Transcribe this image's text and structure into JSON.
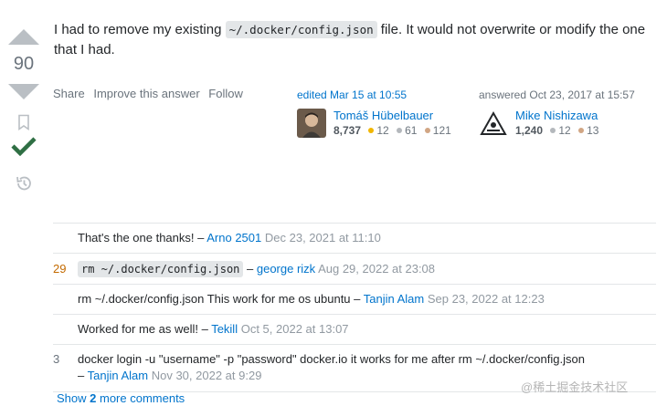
{
  "vote": {
    "count": "90"
  },
  "post": {
    "text_before": "I had to remove my existing ",
    "code": "~/.docker/config.json",
    "text_after": " file. It would not overwrite or modify the one that I had."
  },
  "menu": {
    "share": "Share",
    "improve": "Improve this answer",
    "follow": "Follow"
  },
  "edited": {
    "action": "edited Mar 15 at 10:55",
    "name": "Tomáš Hübelbauer",
    "rep": "8,737",
    "gold": "12",
    "silver": "61",
    "bronze": "121"
  },
  "answered": {
    "action": "answered Oct 23, 2017 at 15:57",
    "name": "Mike Nishizawa",
    "rep": "1,240",
    "silver": "12",
    "bronze": "13"
  },
  "comments": [
    {
      "score": "",
      "text": "That's the one thanks! – ",
      "user": "Arno 2501",
      "date": "Dec 23, 2021 at 11:10"
    },
    {
      "score": "29",
      "code": "rm ~/.docker/config.json",
      "sep": " – ",
      "user": "george rizk",
      "date": "Aug 29, 2022 at 23:08"
    },
    {
      "score": "",
      "text": "rm ~/.docker/config.json This work for me os ubuntu – ",
      "user": "Tanjin Alam",
      "date": "Sep 23, 2022 at 12:23"
    },
    {
      "score": "",
      "text": "Worked for me as well! – ",
      "user": "Tekill",
      "date": "Oct 5, 2022 at 13:07"
    },
    {
      "score": "3",
      "text": "docker login -u \"username\" -p \"password\" docker.io it works for me after rm ~/.docker/config.json",
      "sep": "– ",
      "user": "Tanjin Alam",
      "date": "Nov 30, 2022 at 9:29"
    }
  ],
  "show_more": {
    "prefix": "Show ",
    "count": "2",
    "suffix": " more comments"
  },
  "watermark": "@稀土掘金技术社区",
  "colors": {
    "accent": "#0074cc",
    "accepted": "#2f6f44",
    "hot_score": "#c36a00"
  }
}
